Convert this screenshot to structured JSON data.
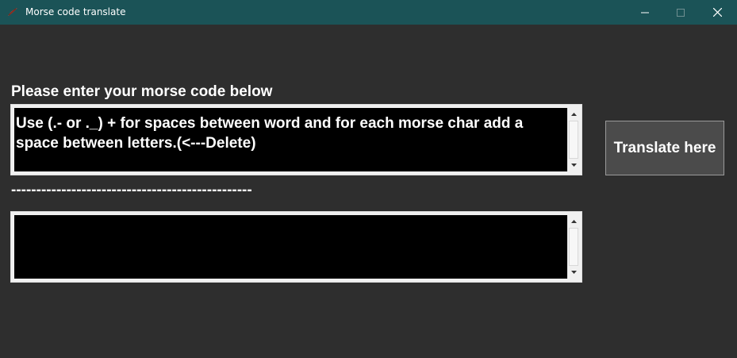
{
  "window": {
    "title": "Morse code translate",
    "titlebar_color": "#1b5357",
    "background_color": "#2e2e2e",
    "controls": [
      "minimize-icon",
      "maximize-icon",
      "close-icon"
    ]
  },
  "main": {
    "prompt_label": "Please enter your morse code below",
    "input_text": "Use (.- or ._) + for spaces between word and for each morse char add a space between letters.(<---Delete)",
    "separator": "------------------------------------------------",
    "output_text": "",
    "translate_button_label": "Translate here"
  }
}
